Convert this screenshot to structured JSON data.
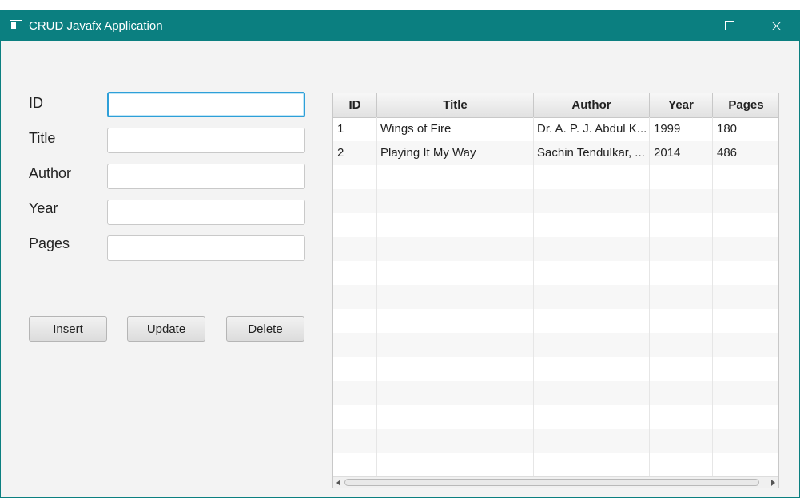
{
  "window": {
    "title": "CRUD Javafx Application"
  },
  "form": {
    "labels": [
      "ID",
      "Title",
      "Author",
      "Year",
      "Pages"
    ],
    "values": [
      "",
      "",
      "",
      "",
      ""
    ],
    "buttons": {
      "insert": "Insert",
      "update": "Update",
      "delete": "Delete"
    }
  },
  "table": {
    "columns": [
      "ID",
      "Title",
      "Author",
      "Year",
      "Pages"
    ],
    "rows": [
      [
        "1",
        "Wings of Fire",
        "Dr. A. P. J. Abdul K...",
        "1999",
        "180"
      ],
      [
        "2",
        "Playing It My Way",
        "Sachin Tendulkar, ...",
        "2014",
        "486"
      ]
    ]
  },
  "colors": {
    "titlebar": "#0b7f80",
    "focus": "#2e9fd8"
  }
}
